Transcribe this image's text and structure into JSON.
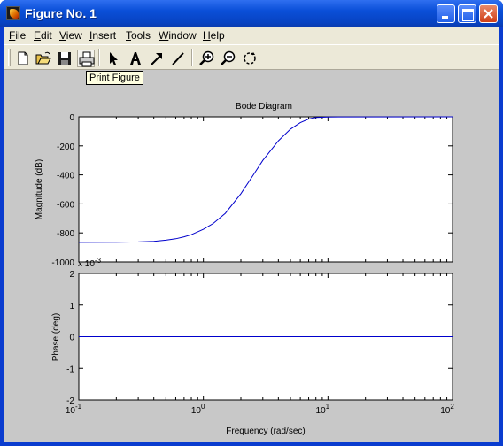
{
  "window": {
    "title": "Figure No. 1"
  },
  "menu": [
    {
      "label": "File",
      "key": "F"
    },
    {
      "label": "Edit",
      "key": "E"
    },
    {
      "label": "View",
      "key": "V"
    },
    {
      "label": "Insert",
      "key": "I"
    },
    {
      "label": "Tools",
      "key": "T"
    },
    {
      "label": "Window",
      "key": "W"
    },
    {
      "label": "Help",
      "key": "H"
    }
  ],
  "toolbar": {
    "tools": [
      "new-file-icon",
      "open-folder-icon",
      "save-icon",
      "print-icon",
      "select-arrow-icon",
      "text-insert-icon",
      "arrow-insert-icon",
      "line-insert-icon",
      "zoom-in-icon",
      "zoom-out-icon",
      "rotate-3d-icon"
    ]
  },
  "tooltip": {
    "text": "Print Figure"
  },
  "chart_data": [
    {
      "type": "line",
      "title": "Bode Diagram",
      "ylabel": "Magnitude (dB)",
      "xscale": "log",
      "xlim": [
        0.1,
        100
      ],
      "ylim": [
        -1000,
        0
      ],
      "yticks": [
        "0",
        "-200",
        "-400",
        "-600",
        "-800",
        "-1000"
      ],
      "exponent_label": "x 10",
      "exponent_value": "-3",
      "series": [
        {
          "color": "#0000CC",
          "x": [
            0.1,
            0.2,
            0.3,
            0.4,
            0.5,
            0.6,
            0.7,
            0.8,
            1.0,
            1.2,
            1.5,
            2.0,
            2.5,
            3.0,
            4.0,
            5.0,
            6.0,
            7.0,
            8.0,
            10.0,
            100.0
          ],
          "y": [
            -865,
            -864,
            -862,
            -858,
            -850,
            -840,
            -827,
            -812,
            -775,
            -735,
            -665,
            -530,
            -405,
            -300,
            -165,
            -85,
            -40,
            -15,
            -4,
            -1,
            0
          ]
        }
      ]
    },
    {
      "type": "line",
      "ylabel": "Phase (deg)",
      "xlabel": "Frequency  (rad/sec)",
      "xscale": "log",
      "xlim": [
        0.1,
        100
      ],
      "ylim": [
        -2,
        2
      ],
      "yticks": [
        "2",
        "1",
        "0",
        "-1",
        "-2"
      ],
      "xticks": [
        {
          "base": "10",
          "exp": "-1"
        },
        {
          "base": "10",
          "exp": "0"
        },
        {
          "base": "10",
          "exp": "1"
        },
        {
          "base": "10",
          "exp": "2"
        }
      ],
      "series": [
        {
          "color": "#0000CC",
          "x": [
            0.1,
            100
          ],
          "y": [
            0,
            0
          ]
        }
      ]
    }
  ]
}
